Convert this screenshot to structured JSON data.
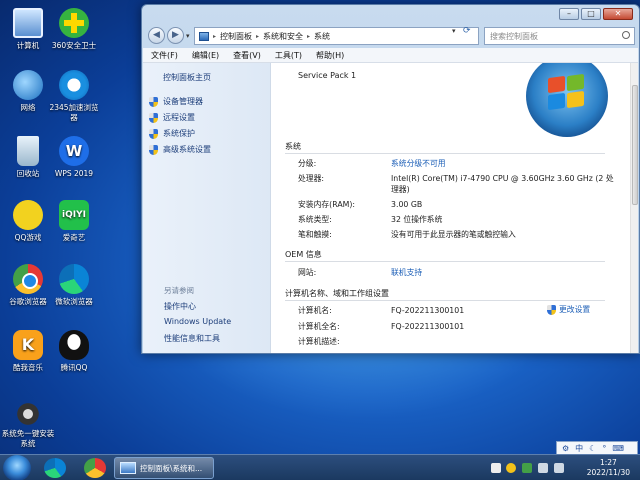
{
  "desktop": {
    "icons": [
      {
        "label": "计算机",
        "icon": "computer-icon"
      },
      {
        "label": "360安全卫士",
        "icon": "360-security-icon"
      },
      {
        "label": "网络",
        "icon": "network-icon"
      },
      {
        "label": "2345加速浏览器",
        "icon": "ie-browser-icon"
      },
      {
        "label": "回收站",
        "icon": "recycle-bin-icon"
      },
      {
        "label": "WPS 2019",
        "icon": "wps-icon"
      },
      {
        "label": "QQ游戏",
        "icon": "qq-game-icon"
      },
      {
        "label": "爱奇艺",
        "icon": "iqiyi-icon"
      },
      {
        "label": "谷歌浏览器",
        "icon": "chrome-icon"
      },
      {
        "label": "微软浏览器",
        "icon": "edge-icon"
      },
      {
        "label": "酷我音乐",
        "icon": "kuwo-icon"
      },
      {
        "label": "腾讯QQ",
        "icon": "qq-icon"
      },
      {
        "label": "系统免一键安装系统",
        "icon": "rabbit-icon"
      }
    ]
  },
  "window": {
    "breadcrumb": [
      "控制面板",
      "系统和安全",
      "系统"
    ],
    "search_placeholder": "搜索控制面板",
    "menu": [
      "文件(F)",
      "编辑(E)",
      "查看(V)",
      "工具(T)",
      "帮助(H)"
    ],
    "left_pane": {
      "home": "控制面板主页",
      "links": [
        "设备管理器",
        "远程设置",
        "系统保护",
        "高级系统设置"
      ],
      "see_also_title": "另请参阅",
      "see_also": [
        "操作中心",
        "Windows Update",
        "性能信息和工具"
      ]
    },
    "service_pack": "Service Pack 1",
    "system_section": {
      "title": "系统",
      "rows": [
        {
          "label": "分级:",
          "value": "系统分级不可用"
        },
        {
          "label": "处理器:",
          "value": "Intel(R) Core(TM) i7-4790 CPU @ 3.60GHz   3.60 GHz  (2 处理器)"
        },
        {
          "label": "安装内存(RAM):",
          "value": "3.00 GB"
        },
        {
          "label": "系统类型:",
          "value": "32 位操作系统"
        },
        {
          "label": "笔和触摸:",
          "value": "没有可用于此显示器的笔或触控输入"
        }
      ]
    },
    "oem_section": {
      "title": "OEM 信息",
      "rows": [
        {
          "label": "网站:",
          "value": "联机支持"
        }
      ]
    },
    "computer_section": {
      "title": "计算机名称、域和工作组设置",
      "change_label": "更改设置",
      "rows": [
        {
          "label": "计算机名:",
          "value": "FQ-202211300101"
        },
        {
          "label": "计算机全名:",
          "value": "FQ-202211300101"
        },
        {
          "label": "计算机描述:",
          "value": ""
        }
      ]
    }
  },
  "taskbar": {
    "task_label": "控制面板\\系统和...",
    "time": "1:27",
    "date": "2022/11/30"
  },
  "language_bar": {
    "lang": "中"
  }
}
